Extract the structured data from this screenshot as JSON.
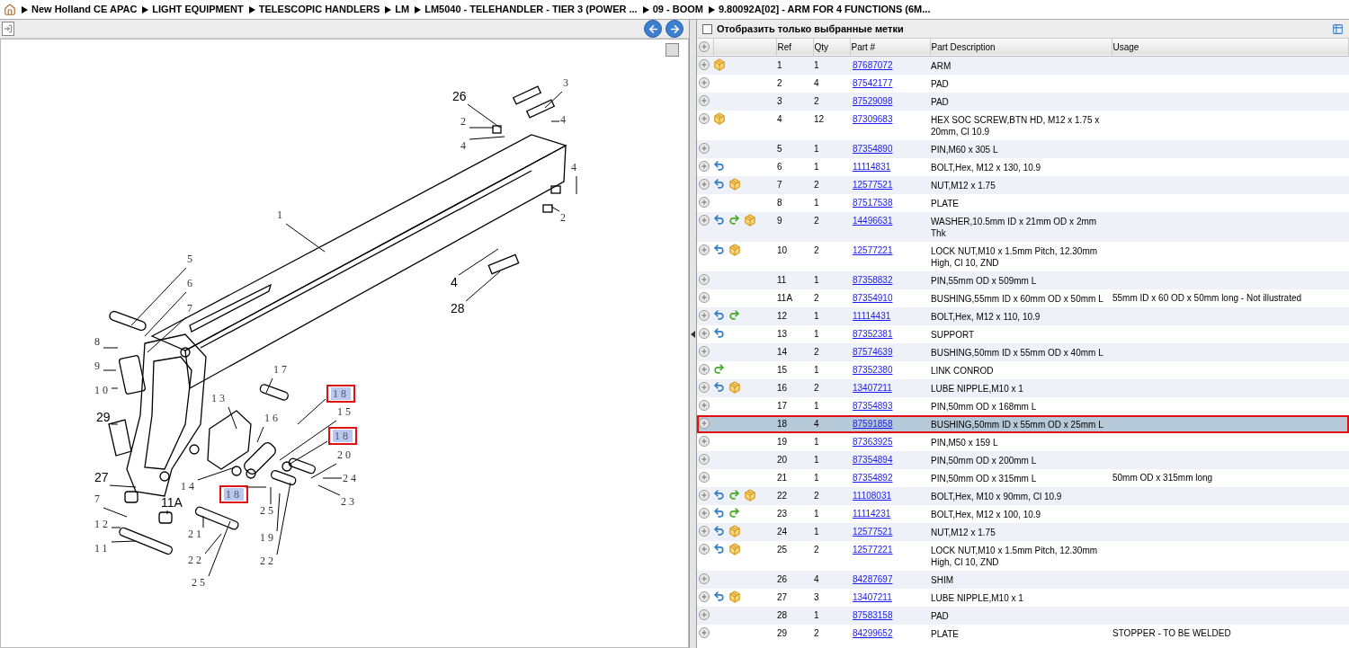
{
  "breadcrumb": [
    "New Holland CE APAC",
    "LIGHT EQUIPMENT",
    "TELESCOPIC HANDLERS",
    "LM",
    "LM5040 - TELEHANDLER - TIER 3 (POWER ...",
    "09 - BOOM",
    "9.80092A[02] - ARM FOR 4 FUNCTIONS (6M..."
  ],
  "diagram": {
    "callouts": [
      {
        "label": "3",
        "kind": "small",
        "selected": false
      },
      {
        "label": "26",
        "kind": "large",
        "selected": false
      },
      {
        "label": "2",
        "kind": "small",
        "selected": false
      },
      {
        "label": "4",
        "kind": "small",
        "selected": false
      },
      {
        "label": "4",
        "kind": "small",
        "selected": false
      },
      {
        "label": "4",
        "kind": "small",
        "selected": false
      },
      {
        "label": "1",
        "kind": "small",
        "selected": false
      },
      {
        "label": "2",
        "kind": "small",
        "selected": false
      },
      {
        "label": "5",
        "kind": "small",
        "selected": false
      },
      {
        "label": "6",
        "kind": "small",
        "selected": false
      },
      {
        "label": "4",
        "kind": "large",
        "selected": false
      },
      {
        "label": "7",
        "kind": "small",
        "selected": false
      },
      {
        "label": "28",
        "kind": "large",
        "selected": false
      },
      {
        "label": "8",
        "kind": "small",
        "selected": false
      },
      {
        "label": "9",
        "kind": "small",
        "selected": false
      },
      {
        "label": "17",
        "kind": "small",
        "selected": false
      },
      {
        "label": "10",
        "kind": "small",
        "selected": false
      },
      {
        "label": "18",
        "kind": "small",
        "selected": true
      },
      {
        "label": "13",
        "kind": "small",
        "selected": false
      },
      {
        "label": "15",
        "kind": "small",
        "selected": false
      },
      {
        "label": "29",
        "kind": "large",
        "selected": false
      },
      {
        "label": "16",
        "kind": "small",
        "selected": false
      },
      {
        "label": "18",
        "kind": "small",
        "selected": true
      },
      {
        "label": "20",
        "kind": "small",
        "selected": false
      },
      {
        "label": "27",
        "kind": "large",
        "selected": false
      },
      {
        "label": "24",
        "kind": "small",
        "selected": false
      },
      {
        "label": "14",
        "kind": "small",
        "selected": false
      },
      {
        "label": "18",
        "kind": "small",
        "selected": true
      },
      {
        "label": "7",
        "kind": "small",
        "selected": false
      },
      {
        "label": "11A",
        "kind": "large",
        "selected": false
      },
      {
        "label": "23",
        "kind": "small",
        "selected": false
      },
      {
        "label": "25",
        "kind": "small",
        "selected": false
      },
      {
        "label": "12",
        "kind": "small",
        "selected": false
      },
      {
        "label": "21",
        "kind": "small",
        "selected": false
      },
      {
        "label": "19",
        "kind": "small",
        "selected": false
      },
      {
        "label": "11",
        "kind": "small",
        "selected": false
      },
      {
        "label": "22",
        "kind": "small",
        "selected": false
      },
      {
        "label": "22",
        "kind": "small",
        "selected": false
      },
      {
        "label": "25",
        "kind": "small",
        "selected": false
      }
    ]
  },
  "filter": {
    "label": "Отобразить только выбранные метки",
    "checked": false
  },
  "table": {
    "columns": [
      "Ref",
      "Qty",
      "Part #",
      "Part Description",
      "Usage"
    ],
    "rows": [
      {
        "ref": "1",
        "qty": "1",
        "part": "87687072",
        "description": "ARM",
        "back_arrow": false,
        "forward_arrow": false,
        "box": true,
        "selected": false
      },
      {
        "ref": "2",
        "qty": "4",
        "part": "87542177",
        "description": "PAD",
        "back_arrow": false,
        "forward_arrow": false,
        "box": false,
        "selected": false
      },
      {
        "ref": "3",
        "qty": "2",
        "part": "87529098",
        "description": "PAD",
        "back_arrow": false,
        "forward_arrow": false,
        "box": false,
        "selected": false
      },
      {
        "ref": "4",
        "qty": "12",
        "part": "87309683",
        "description": "HEX SOC SCREW,BTN HD, M12 x 1.75 x 20mm, Cl 10.9",
        "back_arrow": false,
        "forward_arrow": false,
        "box": true,
        "selected": false
      },
      {
        "ref": "5",
        "qty": "1",
        "part": "87354890",
        "description": "PIN,M60 x 305 L",
        "back_arrow": false,
        "forward_arrow": false,
        "box": false,
        "selected": false
      },
      {
        "ref": "6",
        "qty": "1",
        "part": "11114831",
        "description": "BOLT,Hex, M12 x 130, 10.9",
        "back_arrow": true,
        "forward_arrow": false,
        "box": false,
        "selected": false
      },
      {
        "ref": "7",
        "qty": "2",
        "part": "12577521",
        "description": "NUT,M12 x 1.75",
        "back_arrow": true,
        "forward_arrow": false,
        "box": true,
        "selected": false
      },
      {
        "ref": "8",
        "qty": "1",
        "part": "87517538",
        "description": "PLATE",
        "back_arrow": false,
        "forward_arrow": false,
        "box": false,
        "selected": false
      },
      {
        "ref": "9",
        "qty": "2",
        "part": "14496631",
        "description": "WASHER,10.5mm ID x 21mm OD x 2mm Thk",
        "back_arrow": true,
        "forward_arrow": true,
        "box": true,
        "selected": false
      },
      {
        "ref": "10",
        "qty": "2",
        "part": "12577221",
        "description": "LOCK NUT,M10 x 1.5mm Pitch, 12.30mm High, Cl 10, ZND",
        "back_arrow": true,
        "forward_arrow": false,
        "box": true,
        "selected": false
      },
      {
        "ref": "11",
        "qty": "1",
        "part": "87358832",
        "description": "PIN,55mm OD x 509mm L",
        "back_arrow": false,
        "forward_arrow": false,
        "box": false,
        "selected": false
      },
      {
        "ref": "11A",
        "qty": "2",
        "part": "87354910",
        "description": "BUSHING,55mm ID x 60mm OD x 50mm L",
        "usage": "55mm ID x 60 OD x 50mm long - Not illustrated",
        "back_arrow": false,
        "forward_arrow": false,
        "box": false,
        "selected": false
      },
      {
        "ref": "12",
        "qty": "1",
        "part": "11114431",
        "description": "BOLT,Hex, M12 x 110, 10.9",
        "back_arrow": true,
        "forward_arrow": true,
        "box": false,
        "selected": false
      },
      {
        "ref": "13",
        "qty": "1",
        "part": "87352381",
        "description": "SUPPORT",
        "back_arrow": true,
        "forward_arrow": false,
        "box": false,
        "selected": false
      },
      {
        "ref": "14",
        "qty": "2",
        "part": "87574639",
        "description": "BUSHING,50mm ID x 55mm OD x 40mm L",
        "back_arrow": false,
        "forward_arrow": false,
        "box": false,
        "selected": false
      },
      {
        "ref": "15",
        "qty": "1",
        "part": "87352380",
        "description": "LINK CONROD",
        "back_arrow": false,
        "forward_arrow": true,
        "box": false,
        "selected": false
      },
      {
        "ref": "16",
        "qty": "2",
        "part": "13407211",
        "description": "LUBE NIPPLE,M10 x 1",
        "back_arrow": true,
        "forward_arrow": false,
        "box": true,
        "selected": false
      },
      {
        "ref": "17",
        "qty": "1",
        "part": "87354893",
        "description": "PIN,50mm OD x 168mm L",
        "back_arrow": false,
        "forward_arrow": false,
        "box": false,
        "selected": false
      },
      {
        "ref": "18",
        "qty": "4",
        "part": "87591858",
        "description": "BUSHING,50mm ID x 55mm OD x 25mm L",
        "back_arrow": false,
        "forward_arrow": false,
        "box": false,
        "selected": true
      },
      {
        "ref": "19",
        "qty": "1",
        "part": "87363925",
        "description": "PIN,M50 x 159 L",
        "back_arrow": false,
        "forward_arrow": false,
        "box": false,
        "selected": false
      },
      {
        "ref": "20",
        "qty": "1",
        "part": "87354894",
        "description": "PIN,50mm OD x 200mm L",
        "back_arrow": false,
        "forward_arrow": false,
        "box": false,
        "selected": false
      },
      {
        "ref": "21",
        "qty": "1",
        "part": "87354892",
        "description": "PIN,50mm OD x 315mm L",
        "usage": "50mm OD x 315mm long",
        "back_arrow": false,
        "forward_arrow": false,
        "box": false,
        "selected": false
      },
      {
        "ref": "22",
        "qty": "2",
        "part": "11108031",
        "description": "BOLT,Hex, M10 x 90mm, Cl 10.9",
        "back_arrow": true,
        "forward_arrow": true,
        "box": true,
        "selected": false
      },
      {
        "ref": "23",
        "qty": "1",
        "part": "11114231",
        "description": "BOLT,Hex, M12 x 100, 10.9",
        "back_arrow": true,
        "forward_arrow": true,
        "box": false,
        "selected": false
      },
      {
        "ref": "24",
        "qty": "1",
        "part": "12577521",
        "description": "NUT,M12 x 1.75",
        "back_arrow": true,
        "forward_arrow": false,
        "box": true,
        "selected": false
      },
      {
        "ref": "25",
        "qty": "2",
        "part": "12577221",
        "description": "LOCK NUT,M10 x 1.5mm Pitch, 12.30mm High, Cl 10, ZND",
        "back_arrow": true,
        "forward_arrow": false,
        "box": true,
        "selected": false
      },
      {
        "ref": "26",
        "qty": "4",
        "part": "84287697",
        "description": "SHIM",
        "back_arrow": false,
        "forward_arrow": false,
        "box": false,
        "selected": false
      },
      {
        "ref": "27",
        "qty": "3",
        "part": "13407211",
        "description": "LUBE NIPPLE,M10 x 1",
        "back_arrow": true,
        "forward_arrow": false,
        "box": true,
        "selected": false
      },
      {
        "ref": "28",
        "qty": "1",
        "part": "87583158",
        "description": "PAD",
        "back_arrow": false,
        "forward_arrow": false,
        "box": false,
        "selected": false
      },
      {
        "ref": "29",
        "qty": "2",
        "part": "84299652",
        "description": "PLATE",
        "usage": "STOPPER - TO BE WELDED",
        "back_arrow": false,
        "forward_arrow": false,
        "box": false,
        "selected": false
      }
    ]
  }
}
